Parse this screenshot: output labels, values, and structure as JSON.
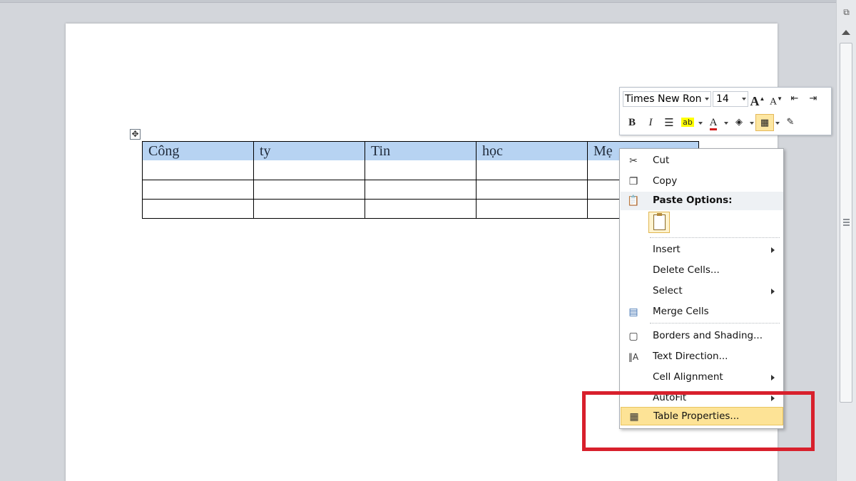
{
  "table": {
    "rows": [
      [
        "Công",
        "ty",
        "Tin",
        "học",
        "Mẹ"
      ],
      [
        "",
        "",
        "",
        "",
        ""
      ],
      [
        "",
        "",
        "",
        "",
        ""
      ]
    ]
  },
  "mini_toolbar": {
    "font_name": "Times New Ron",
    "font_size": "14",
    "grow_font_icon": "A",
    "shrink_font_icon": "A",
    "bold_label": "B",
    "italic_label": "I",
    "font_color_label": "A"
  },
  "context_menu": {
    "items": [
      {
        "label": "Cut",
        "icon": "scissors-icon"
      },
      {
        "label": "Copy",
        "icon": "copy-icon"
      },
      {
        "label": "Paste Options:",
        "icon": "paste-icon"
      },
      {
        "label": "Insert",
        "submenu": true
      },
      {
        "label": "Delete Cells..."
      },
      {
        "label": "Select",
        "submenu": true
      },
      {
        "label": "Merge Cells",
        "icon": "merge-cells-icon"
      },
      {
        "label": "Borders and Shading...",
        "icon": "borders-icon"
      },
      {
        "label": "Text Direction...",
        "icon": "text-direction-icon"
      },
      {
        "label": "Cell Alignment",
        "submenu": true
      },
      {
        "label": "AutoFit",
        "submenu": true
      },
      {
        "label": "Table Properties...",
        "icon": "table-properties-icon",
        "highlighted": true
      }
    ]
  },
  "colors": {
    "highlight_selection": "#b7d3f2",
    "menu_hover": "#fde396",
    "annotation_red": "#d8202c"
  }
}
